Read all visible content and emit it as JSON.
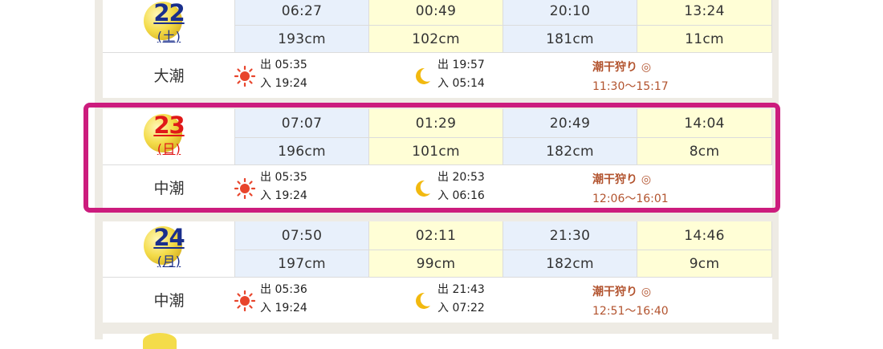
{
  "days": [
    {
      "num": "22",
      "dow": "(土)",
      "red": false,
      "tide": "大潮",
      "times": [
        "06:27",
        "00:49",
        "20:10",
        "13:24"
      ],
      "heights": [
        "193cm",
        "102cm",
        "181cm",
        "11cm"
      ],
      "sun_rise": "出 05:35",
      "sun_set": "入 19:24",
      "moon_rise": "出 19:57",
      "moon_set": "入 05:14",
      "shiohigari": "潮干狩り ◎",
      "shiohigari_time": "11:30〜15:17"
    },
    {
      "num": "23",
      "dow": "(日)",
      "red": true,
      "tide": "中潮",
      "times": [
        "07:07",
        "01:29",
        "20:49",
        "14:04"
      ],
      "heights": [
        "196cm",
        "101cm",
        "182cm",
        "8cm"
      ],
      "sun_rise": "出 05:35",
      "sun_set": "入 19:24",
      "moon_rise": "出 20:53",
      "moon_set": "入 06:16",
      "shiohigari": "潮干狩り ◎",
      "shiohigari_time": "12:06〜16:01"
    },
    {
      "num": "24",
      "dow": "(月)",
      "red": false,
      "tide": "中潮",
      "times": [
        "07:50",
        "02:11",
        "21:30",
        "14:46"
      ],
      "heights": [
        "197cm",
        "99cm",
        "182cm",
        "9cm"
      ],
      "sun_rise": "出 05:36",
      "sun_set": "入 19:24",
      "moon_rise": "出 21:43",
      "moon_set": "入 07:22",
      "shiohigari": "潮干狩り ◎",
      "shiohigari_time": "12:51〜16:40"
    }
  ],
  "colors": {
    "highlight": "#cc1c7d",
    "accent": "#b2532e",
    "sun": "#e8452c",
    "moon": "#f2b90f"
  }
}
